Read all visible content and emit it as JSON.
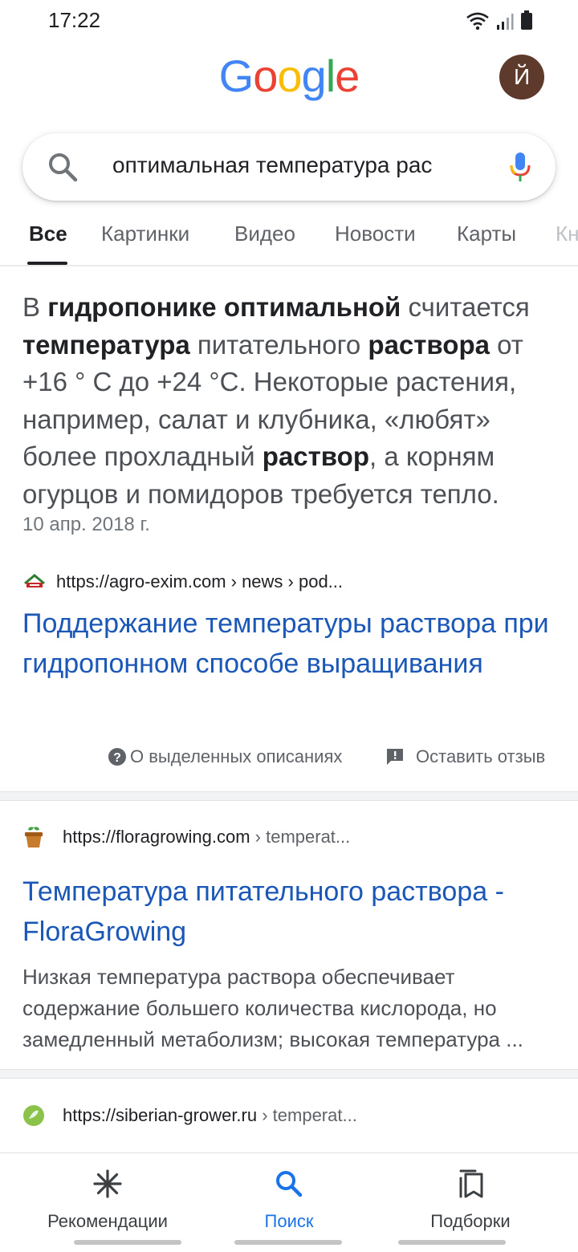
{
  "status_bar": {
    "time": "17:22"
  },
  "header": {
    "logo_letters": [
      "G",
      "o",
      "o",
      "g",
      "l",
      "e"
    ],
    "logo_colors": [
      "#4285F4",
      "#EA4335",
      "#FBBC05",
      "#4285F4",
      "#34A853",
      "#EA4335"
    ],
    "avatar_letter": "Й",
    "avatar_color": "#5d3a2c"
  },
  "search": {
    "query": "оптимальная температура рас"
  },
  "tabs": [
    {
      "label": "Все",
      "active": true
    },
    {
      "label": "Картинки"
    },
    {
      "label": "Видео"
    },
    {
      "label": "Новости"
    },
    {
      "label": "Карты"
    },
    {
      "label": "Кн"
    }
  ],
  "featured_snippet": {
    "segments": [
      {
        "text": "В ",
        "bold": false
      },
      {
        "text": "гидропонике оптимальной",
        "bold": true
      },
      {
        "text": " считается ",
        "bold": false
      },
      {
        "text": "температура",
        "bold": true
      },
      {
        "text": " питательного ",
        "bold": false
      },
      {
        "text": "раствора",
        "bold": true
      },
      {
        "text": " от +16 ° С до +24 °С. Некоторые растения, например, салат и клубника, «любят» более прохладный ",
        "bold": false
      },
      {
        "text": "раствор",
        "bold": true
      },
      {
        "text": ", а корням огурцов и помидоров требуется тепло.",
        "bold": false
      }
    ],
    "date": "10 апр. 2018 г.",
    "source_url": "https://agro-exim.com › news › pod...",
    "title": "Поддержание температуры раствора при гидропонном способе выращивания",
    "about_label": "О выделенных описаниях",
    "feedback_label": "Оставить отзыв"
  },
  "results": [
    {
      "url_main": "https://floragrowing.com",
      "url_tail": " › temperat...",
      "title": "Температура питательного раствора - FloraGrowing",
      "description": "Низкая температура раствора обеспечивает содержание большего количества кислорода, но замедленный метаболизм; высокая температура ..."
    },
    {
      "url_main": "https://siberian-grower.ru",
      "url_tail": " › temperat..."
    }
  ],
  "bottom_nav": [
    {
      "label": "Рекомендации",
      "icon": "asterisk-icon"
    },
    {
      "label": "Поиск",
      "icon": "search-icon",
      "active": true
    },
    {
      "label": "Подборки",
      "icon": "collections-icon"
    }
  ],
  "colors": {
    "link": "#1a57b7",
    "active_nav": "#1a73e8"
  }
}
